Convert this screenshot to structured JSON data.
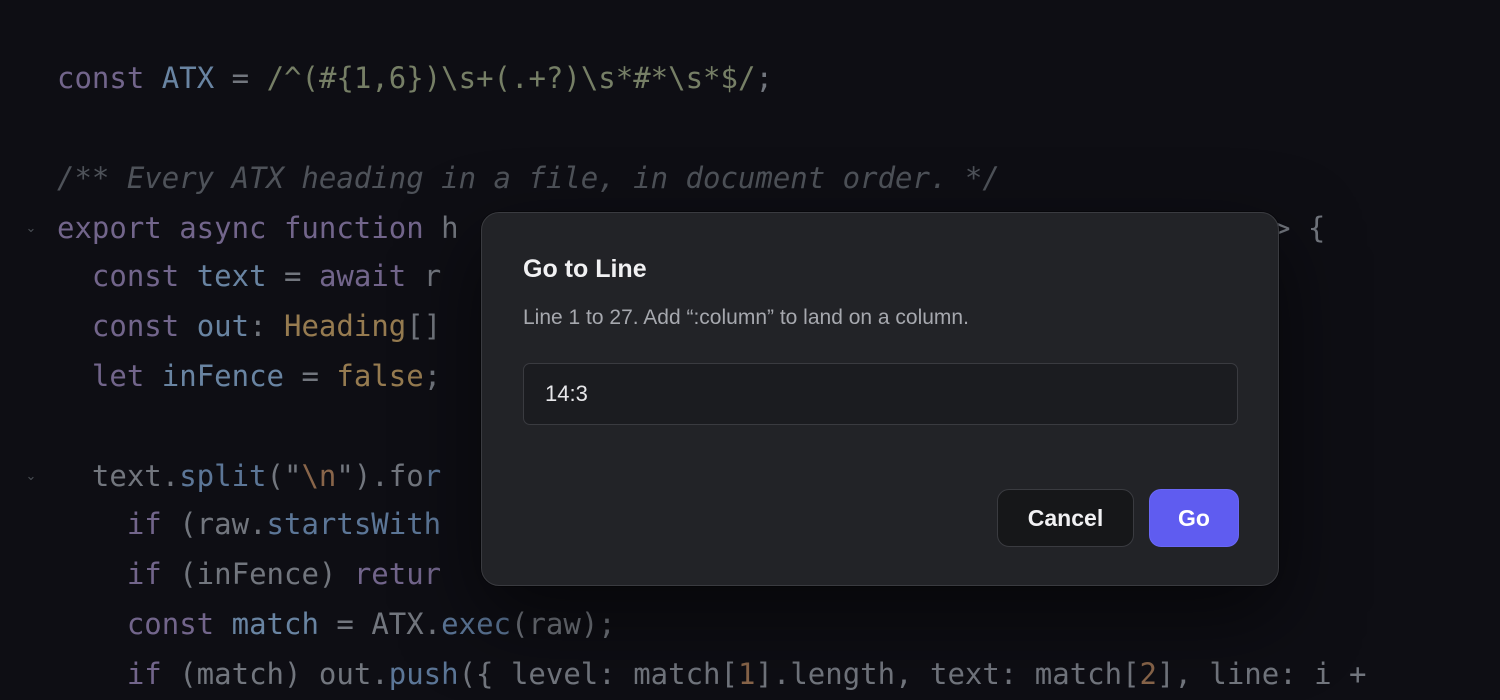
{
  "editor": {
    "lines": [
      [
        [
          "kw",
          "const"
        ],
        [
          "pl",
          " "
        ],
        [
          "vr",
          "ATX"
        ],
        [
          "pl",
          " = "
        ],
        [
          "str",
          "/^(#{1,6})\\s+(.+?)\\s*#*\\s*$/"
        ],
        [
          "pl",
          ";"
        ]
      ],
      [],
      [
        [
          "cm",
          "/** Every ATX heading in a file, in document order. */"
        ]
      ],
      [
        [
          "kw",
          "export async function"
        ],
        [
          "pl",
          " h"
        ]
      ],
      [
        [
          "pl",
          "  "
        ],
        [
          "kw",
          "const"
        ],
        [
          "pl",
          " "
        ],
        [
          "vr",
          "text"
        ],
        [
          "pl",
          " = "
        ],
        [
          "kw",
          "await"
        ],
        [
          "pl",
          " r"
        ]
      ],
      [
        [
          "pl",
          "  "
        ],
        [
          "kw",
          "const"
        ],
        [
          "pl",
          " "
        ],
        [
          "vr",
          "out"
        ],
        [
          "pl",
          ": "
        ],
        [
          "type",
          "Heading"
        ],
        [
          "pl",
          "[]"
        ]
      ],
      [
        [
          "pl",
          "  "
        ],
        [
          "kw",
          "let"
        ],
        [
          "pl",
          " "
        ],
        [
          "vr",
          "inFence"
        ],
        [
          "pl",
          " = "
        ],
        [
          "bool",
          "false"
        ],
        [
          "pl",
          ";"
        ]
      ],
      [],
      [
        [
          "pl",
          "  text."
        ],
        [
          "fn",
          "split"
        ],
        [
          "pl",
          "(\""
        ],
        [
          "num",
          "\\n"
        ],
        [
          "pl",
          "\").fo"
        ],
        [
          "fn",
          "r"
        ]
      ],
      [
        [
          "pl",
          "    "
        ],
        [
          "kw",
          "if"
        ],
        [
          "pl",
          " (raw."
        ],
        [
          "fn",
          "startsWith"
        ]
      ],
      [
        [
          "pl",
          "    "
        ],
        [
          "kw",
          "if"
        ],
        [
          "pl",
          " (inFence) "
        ],
        [
          "kw",
          "retur"
        ]
      ],
      [
        [
          "pl",
          "    "
        ],
        [
          "kw",
          "const"
        ],
        [
          "pl",
          " "
        ],
        [
          "vr",
          "match"
        ],
        [
          "pl",
          " = ATX."
        ],
        [
          "fn",
          "exec"
        ],
        [
          "pl",
          "(raw);"
        ]
      ],
      [
        [
          "pl",
          "    "
        ],
        [
          "kw",
          "if"
        ],
        [
          "pl",
          " (match) out."
        ],
        [
          "fn",
          "push"
        ],
        [
          "pl",
          "({ level: match["
        ],
        [
          "num",
          "1"
        ],
        [
          "pl",
          "].length, text: match["
        ],
        [
          "num",
          "2"
        ],
        [
          "pl",
          "], line: i +"
        ]
      ]
    ],
    "tail_text": "> {"
  },
  "dialog": {
    "title": "Go to Line",
    "subtitle": "Line 1 to 27. Add “:column” to land on a column.",
    "input_value": "14:3",
    "cancel_label": "Cancel",
    "go_label": "Go"
  },
  "colors": {
    "accent": "#5f5cf0",
    "dialog_bg": "#222327",
    "editor_bg": "#101116"
  }
}
